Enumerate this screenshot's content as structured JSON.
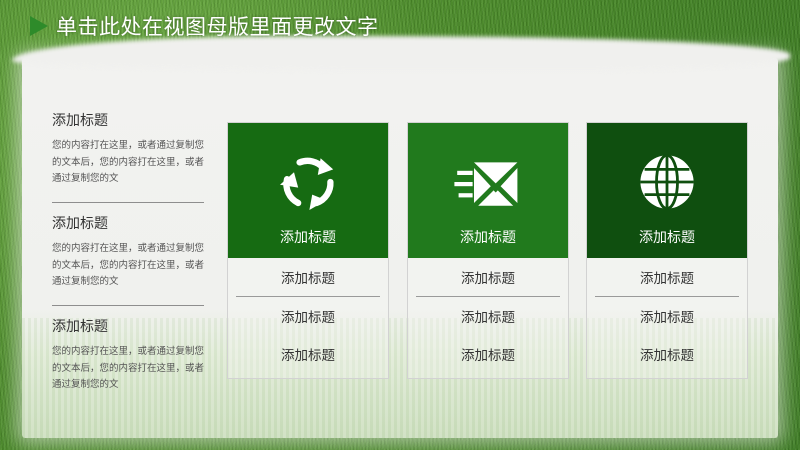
{
  "header": {
    "title": "单击此处在视图母版里面更改文字"
  },
  "colors": {
    "card1": "#166b12",
    "card2": "#217a1d",
    "card3": "#0f4f0f",
    "accent": "#2e8b2a"
  },
  "left_items": [
    {
      "title": "添加标题",
      "body": "您的内容打在这里，或者通过复制您的文本后，您的内容打在这里，或者通过复制您的文"
    },
    {
      "title": "添加标题",
      "body": "您的内容打在这里，或者通过复制您的文本后，您的内容打在这里，或者通过复制您的文"
    },
    {
      "title": "添加标题",
      "body": "您的内容打在这里，或者通过复制您的文本后，您的内容打在这里，或者通过复制您的文"
    }
  ],
  "cards": [
    {
      "icon": "recycle-icon",
      "title": "添加标题",
      "rows": [
        "添加标题",
        "添加标题",
        "添加标题"
      ]
    },
    {
      "icon": "mail-icon",
      "title": "添加标题",
      "rows": [
        "添加标题",
        "添加标题",
        "添加标题"
      ]
    },
    {
      "icon": "globe-icon",
      "title": "添加标题",
      "rows": [
        "添加标题",
        "添加标题",
        "添加标题"
      ]
    }
  ]
}
